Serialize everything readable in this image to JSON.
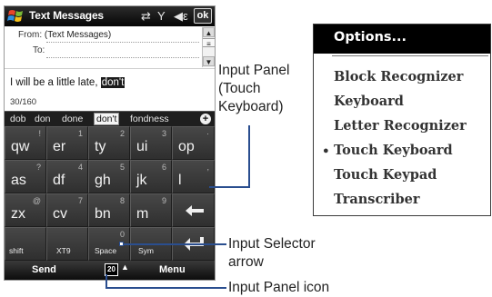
{
  "phone": {
    "title": "Text Messages",
    "title_icons": [
      "connectivity-icon",
      "signal-icon",
      "volume-icon"
    ],
    "ok_label": "ok",
    "from_label": "From:",
    "from_value": "(Text Messages)",
    "to_label": "To:",
    "message_text": "I will be a little late, ",
    "message_selected": "don't",
    "char_count": "30/160",
    "suggestions": [
      "dob",
      "don",
      "done",
      "don't",
      "fondness"
    ],
    "suggestion_selected_index": 3,
    "keyboard": {
      "row1": [
        {
          "main": "qw",
          "alt": "!"
        },
        {
          "main": "er",
          "alt": "1"
        },
        {
          "main": "ty",
          "alt": "2"
        },
        {
          "main": "ui",
          "alt": "3"
        },
        {
          "main": "op",
          "alt": "·"
        }
      ],
      "row2": [
        {
          "main": "as",
          "alt": "?"
        },
        {
          "main": "df",
          "alt": "4"
        },
        {
          "main": "gh",
          "alt": "5"
        },
        {
          "main": "jk",
          "alt": "6"
        },
        {
          "main": "l",
          "alt": ","
        }
      ],
      "row3": [
        {
          "main": "zx",
          "alt": "@"
        },
        {
          "main": "cv",
          "alt": "7"
        },
        {
          "main": "bn",
          "alt": "8"
        },
        {
          "main": "m",
          "alt": "9"
        }
      ],
      "row4": [
        {
          "main": "shift",
          "alt": ""
        },
        {
          "main": "XT9",
          "alt": ""
        },
        {
          "main": "Space",
          "alt": "0"
        },
        {
          "main": "Sym",
          "alt": ""
        }
      ],
      "backspace_icon": "backspace-arrow-icon",
      "enter_icon": "enter-icon"
    },
    "softkey_left": "Send",
    "softkey_right": "Menu",
    "input_panel_icon_text": "20"
  },
  "callouts": {
    "input_panel_line1": "Input Panel",
    "input_panel_line2": "(Touch",
    "input_panel_line3": "Keyboard)",
    "selector_line1": "Input Selector",
    "selector_line2": "arrow",
    "icon_label": "Input Panel icon"
  },
  "options_menu": {
    "title": "Options...",
    "items": [
      "Block Recognizer",
      "Keyboard",
      "Letter Recognizer",
      "Touch Keyboard",
      "Touch Keypad",
      "Transcriber"
    ],
    "selected_index": 3
  },
  "colors": {
    "callout_line": "#2a4e8f",
    "keyboard_bg": "#3a3a3a",
    "titlebar_bg": "#0a0a0a"
  }
}
